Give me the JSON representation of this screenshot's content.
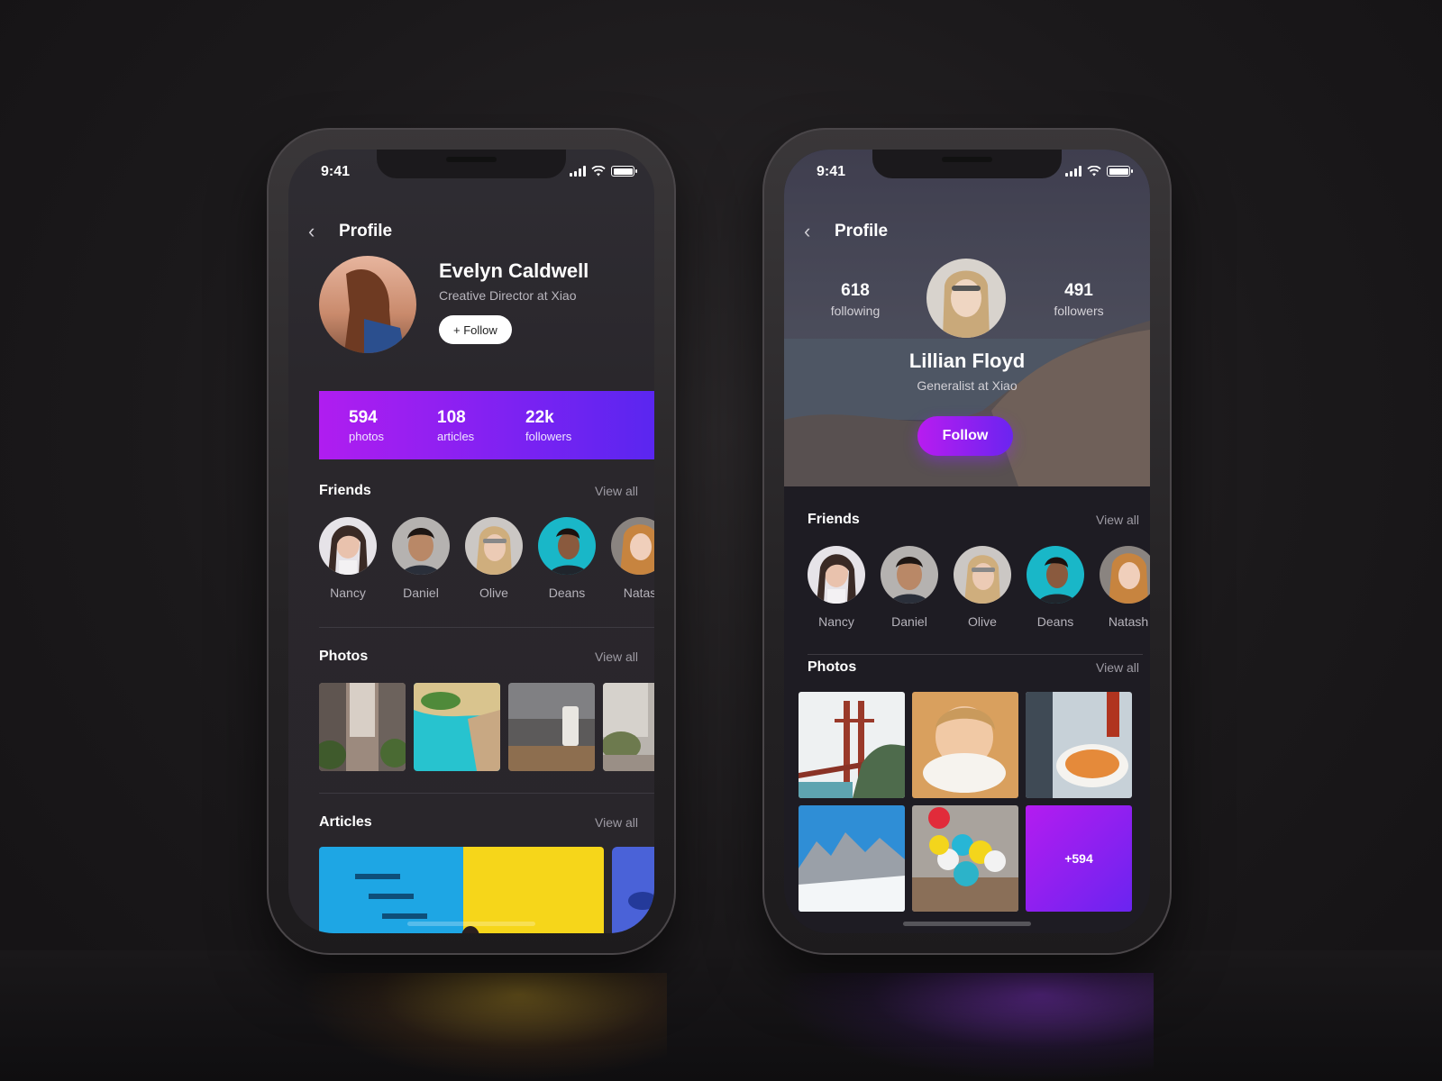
{
  "status": {
    "time": "9:41"
  },
  "left_phone": {
    "nav": {
      "title": "Profile"
    },
    "profile": {
      "name": "Evelyn Caldwell",
      "role": "Creative Director at Xiao",
      "follow_label": "+ Follow"
    },
    "stats": [
      {
        "value": "594",
        "label": "photos"
      },
      {
        "value": "108",
        "label": "articles"
      },
      {
        "value": "22k",
        "label": "followers"
      }
    ],
    "friends": {
      "heading": "Friends",
      "view_all": "View all",
      "items": [
        {
          "name": "Nancy"
        },
        {
          "name": "Daniel"
        },
        {
          "name": "Olive"
        },
        {
          "name": "Deans"
        },
        {
          "name": "Natas"
        }
      ]
    },
    "photos": {
      "heading": "Photos",
      "view_all": "View all"
    },
    "articles": {
      "heading": "Articles",
      "view_all": "View all"
    }
  },
  "right_phone": {
    "nav": {
      "title": "Profile"
    },
    "profile": {
      "following_count": "618",
      "following_label": "following",
      "followers_count": "491",
      "followers_label": "followers",
      "name": "Lillian Floyd",
      "role": "Generalist at Xiao",
      "follow_label": "Follow"
    },
    "friends": {
      "heading": "Friends",
      "view_all": "View all",
      "items": [
        {
          "name": "Nancy"
        },
        {
          "name": "Daniel"
        },
        {
          "name": "Olive"
        },
        {
          "name": "Deans"
        },
        {
          "name": "Natash"
        }
      ]
    },
    "photos": {
      "heading": "Photos",
      "view_all": "View all",
      "more_label": "+594"
    }
  },
  "colors": {
    "accent_start": "#b01df0",
    "accent_end": "#5a26f0",
    "background": "#1b191b",
    "muted_text": "#9e9ba4"
  },
  "icons": [
    "back-chevron-icon",
    "cellular-signal-icon",
    "wifi-icon",
    "battery-icon"
  ]
}
